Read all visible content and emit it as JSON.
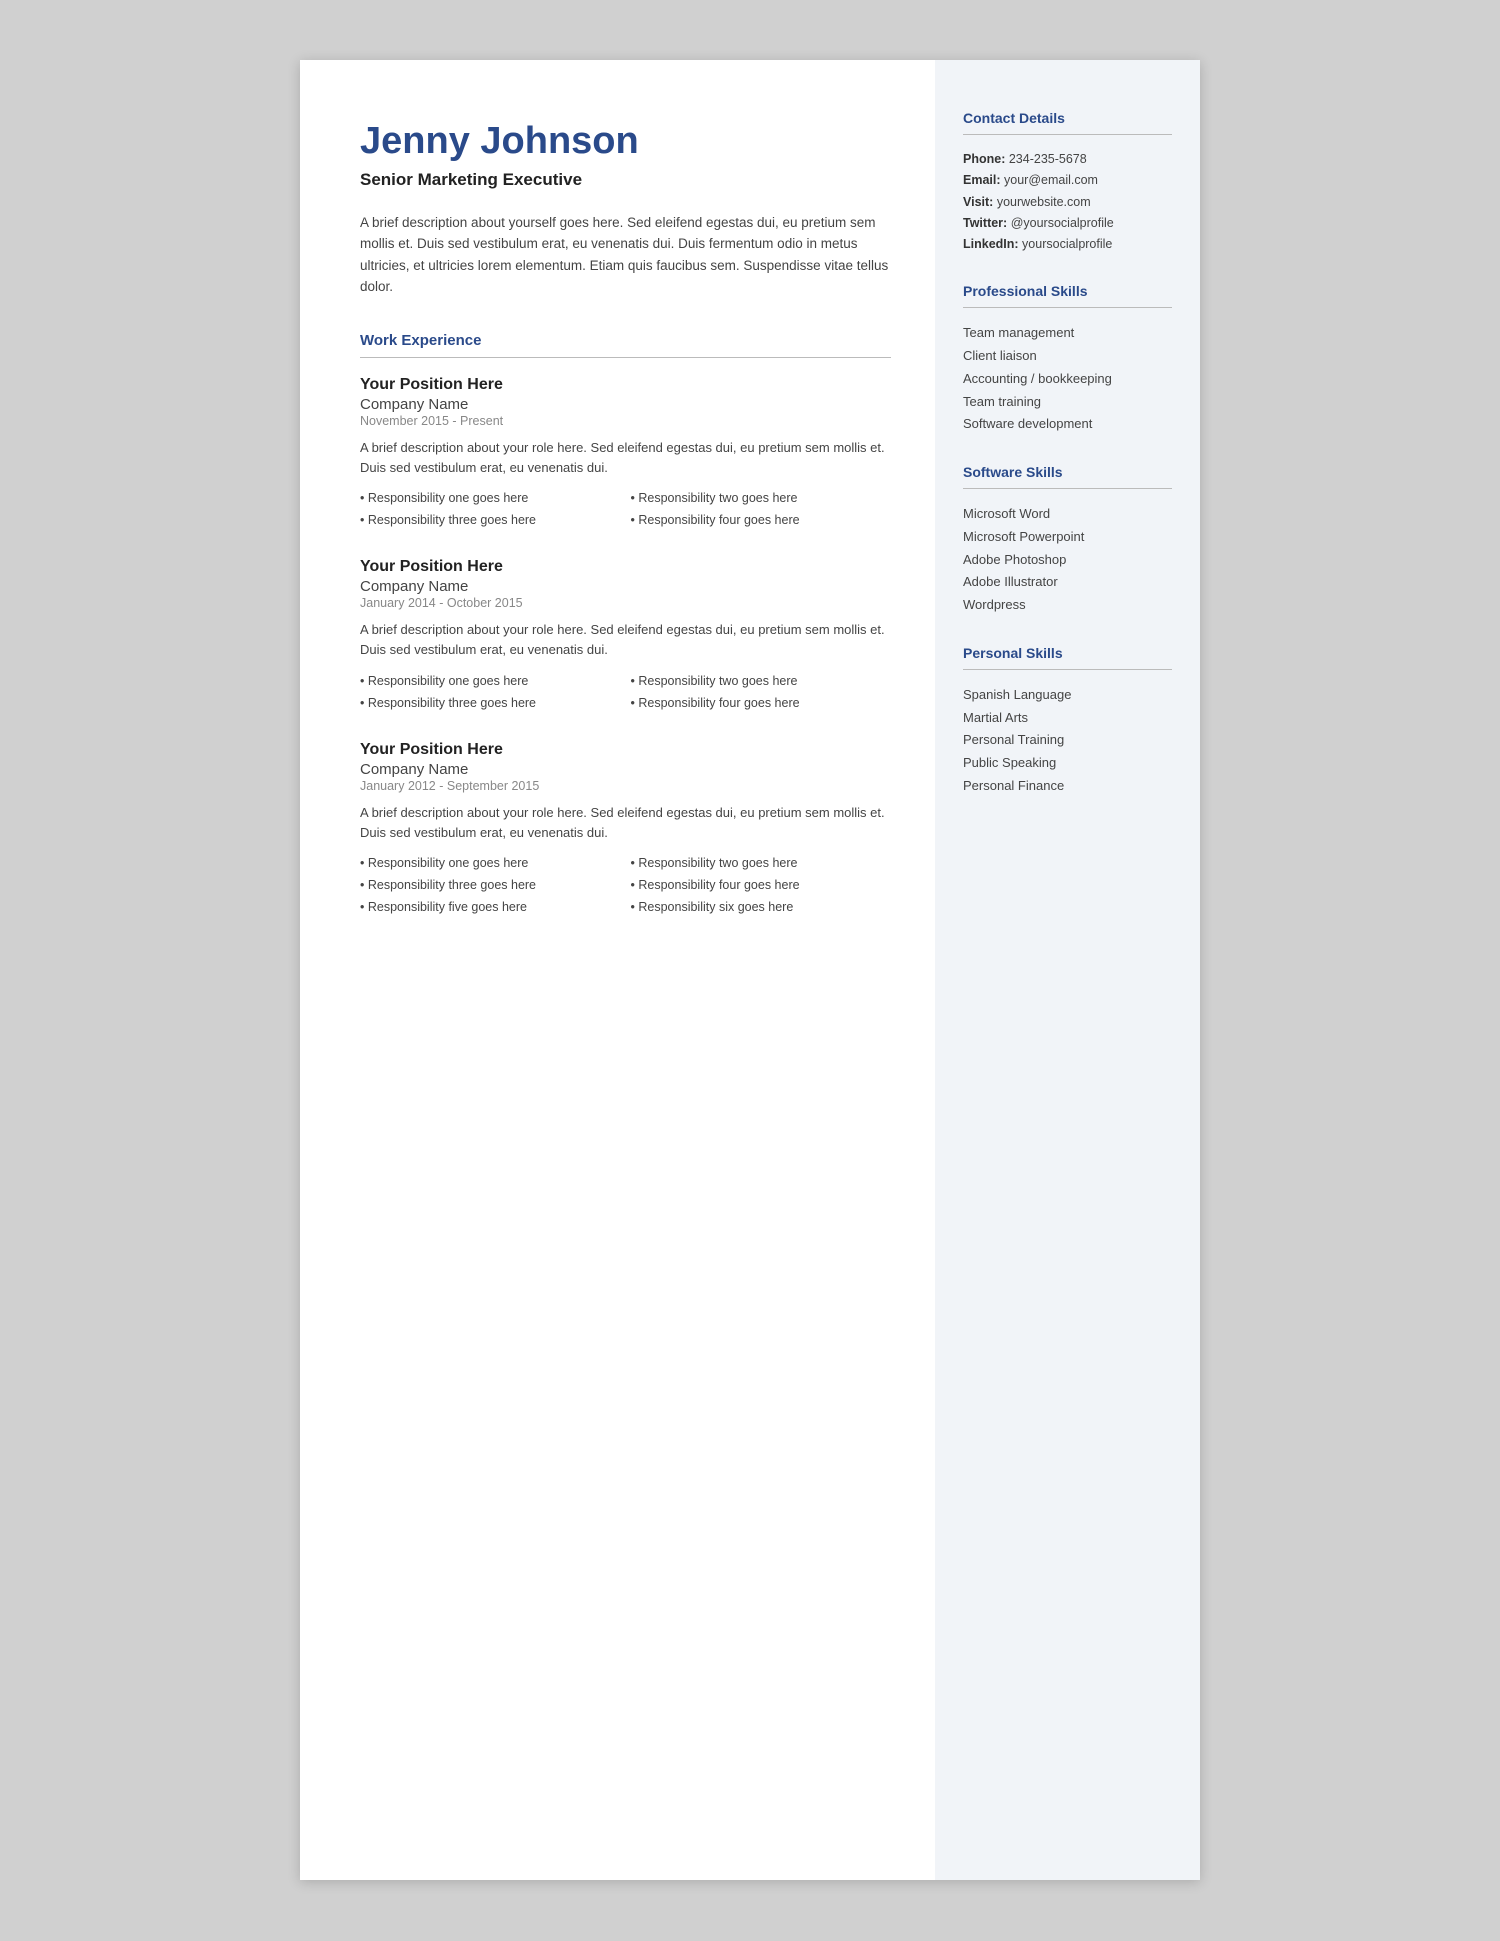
{
  "header": {
    "name": "Jenny Johnson",
    "title": "Senior Marketing Executive",
    "bio": "A brief description about yourself goes here. Sed eleifend egestas dui, eu pretium sem mollis et. Duis sed vestibulum erat, eu venenatis dui. Duis fermentum odio in metus ultricies, et ultricies lorem elementum. Etiam quis faucibus sem. Suspendisse vitae tellus dolor."
  },
  "sections": {
    "work_experience_label": "Work Experience"
  },
  "jobs": [
    {
      "position": "Your Position Here",
      "company": "Company Name",
      "dates": "November 2015 - Present",
      "description": "A brief description about your role here. Sed eleifend egestas dui, eu pretium sem mollis et. Duis sed vestibulum erat, eu venenatis dui.",
      "responsibilities": [
        "Responsibility one goes here",
        "Responsibility two goes here",
        "Responsibility three goes here",
        "Responsibility four goes here"
      ]
    },
    {
      "position": "Your Position Here",
      "company": "Company Name",
      "dates": "January 2014 - October 2015",
      "description": "A brief description about your role here. Sed eleifend egestas dui, eu pretium sem mollis et. Duis sed vestibulum erat, eu venenatis dui.",
      "responsibilities": [
        "Responsibility one goes here",
        "Responsibility two goes here",
        "Responsibility three goes here",
        "Responsibility four goes here"
      ]
    },
    {
      "position": "Your Position Here",
      "company": "Company Name",
      "dates": "January 2012 - September 2015",
      "description": "A brief description about your role here. Sed eleifend egestas dui, eu pretium sem mollis et. Duis sed vestibulum erat, eu venenatis dui.",
      "responsibilities": [
        "Responsibility one goes here",
        "Responsibility two goes here",
        "Responsibility three goes here",
        "Responsibility four goes here",
        "Responsibility five goes here",
        "Responsibility six goes here"
      ]
    }
  ],
  "sidebar": {
    "contact_label": "Contact Details",
    "contact": {
      "phone_label": "Phone:",
      "phone": "234-235-5678",
      "email_label": "Email:",
      "email": "your@email.com",
      "visit_label": "Visit:",
      "visit": " yourwebsite.com",
      "twitter_label": "Twitter:",
      "twitter": "@yoursocialprofile",
      "linkedin_label": "LinkedIn:",
      "linkedin": "yoursocialprofile"
    },
    "professional_skills_label": "Professional Skills",
    "professional_skills": [
      "Team management",
      "Client liaison",
      "Accounting / bookkeeping",
      "Team training",
      "Software development"
    ],
    "software_skills_label": "Software Skills",
    "software_skills": [
      "Microsoft Word",
      "Microsoft Powerpoint",
      "Adobe Photoshop",
      "Adobe Illustrator",
      "Wordpress"
    ],
    "personal_skills_label": "Personal Skills",
    "personal_skills": [
      "Spanish Language",
      "Martial Arts",
      "Personal Training",
      "Public Speaking",
      "Personal Finance"
    ]
  }
}
